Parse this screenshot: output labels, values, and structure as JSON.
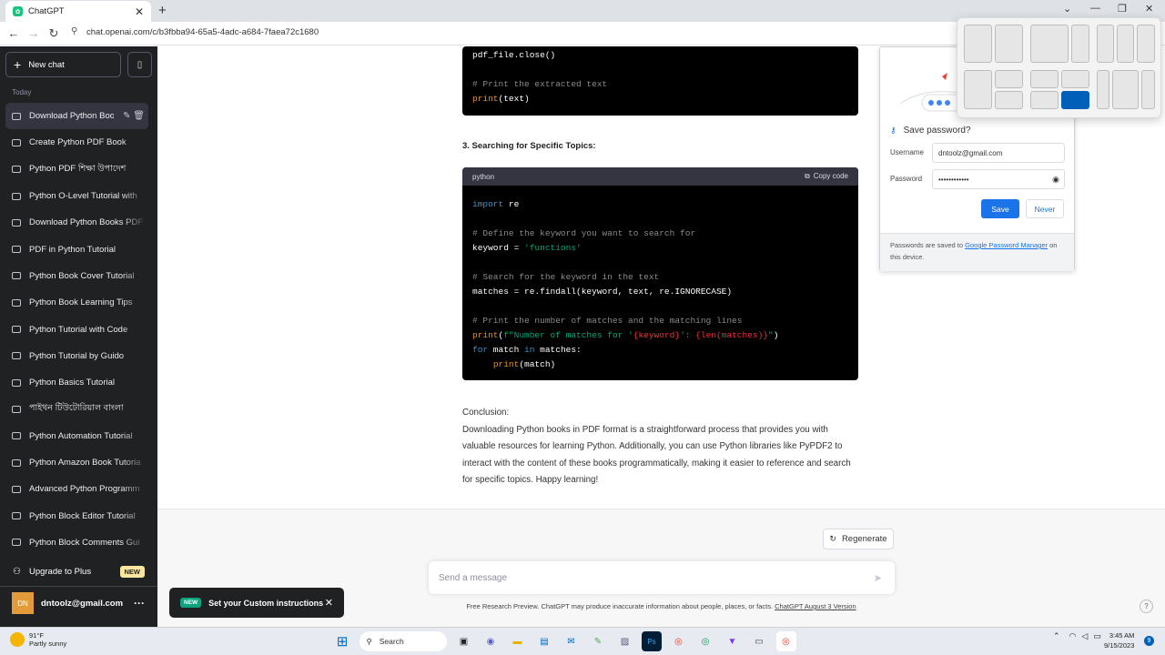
{
  "browser": {
    "tab_title": "ChatGPT",
    "tab_close": "✕",
    "new_tab": "+",
    "url": "chat.openai.com/c/b3fbba94-65a5-4adc-a684-7faea72c1680",
    "controls": {
      "chevron": "⌄",
      "minimize": "—",
      "restore": "❐",
      "close": "✕"
    }
  },
  "sidebar": {
    "new_chat": "New chat",
    "section_label": "Today",
    "items": [
      {
        "label": "Download Python Boo",
        "active": true
      },
      {
        "label": "Create Python PDF Book"
      },
      {
        "label": "Python PDF শিক্ষা উপাদেশ"
      },
      {
        "label": "Python O-Level Tutorial with"
      },
      {
        "label": "Download Python Books PDF"
      },
      {
        "label": "PDF in Python Tutorial"
      },
      {
        "label": "Python Book Cover Tutorial"
      },
      {
        "label": "Python Book Learning Tips"
      },
      {
        "label": "Python Tutorial with Code"
      },
      {
        "label": "Python Tutorial by Guido"
      },
      {
        "label": "Python Basics Tutorial"
      },
      {
        "label": "পাইথন টিউটোরিয়াল বাংলা"
      },
      {
        "label": "Python Automation Tutorial"
      },
      {
        "label": "Python Amazon Book Tutoria"
      },
      {
        "label": "Advanced Python Programm"
      },
      {
        "label": "Python Block Editor Tutorial"
      },
      {
        "label": "Python Block Comments Gui"
      }
    ],
    "upgrade_label": "Upgrade to Plus",
    "upgrade_badge": "NEW",
    "user_avatar": "DN",
    "user_email": "dntoolz@gmail.com",
    "user_menu": "···"
  },
  "conversation": {
    "code1_lines": [
      [
        {
          "t": "pdf_file.close()",
          "c": ""
        }
      ],
      [
        {
          "t": "",
          "c": ""
        }
      ],
      [
        {
          "t": "# Print the extracted text",
          "c": "cm"
        }
      ],
      [
        {
          "t": "print",
          "c": "bi"
        },
        {
          "t": "(text)",
          "c": ""
        }
      ]
    ],
    "heading3": "3. Searching for Specific Topics:",
    "code2_lang": "python",
    "code2_copy": "Copy code",
    "code2_lines": [
      [
        {
          "t": "import",
          "c": "kw"
        },
        {
          "t": " re",
          "c": ""
        }
      ],
      [
        {
          "t": "",
          "c": ""
        }
      ],
      [
        {
          "t": "# Define the keyword you want to search for",
          "c": "cm"
        }
      ],
      [
        {
          "t": "keyword = ",
          "c": ""
        },
        {
          "t": "'functions'",
          "c": "st"
        }
      ],
      [
        {
          "t": "",
          "c": ""
        }
      ],
      [
        {
          "t": "# Search for the keyword in the text",
          "c": "cm"
        }
      ],
      [
        {
          "t": "matches = re.findall(keyword, text, re.IGNORECASE)",
          "c": ""
        }
      ],
      [
        {
          "t": "",
          "c": ""
        }
      ],
      [
        {
          "t": "# Print the number of matches and the matching lines",
          "c": "cm"
        }
      ],
      [
        {
          "t": "print",
          "c": "bi"
        },
        {
          "t": "(",
          "c": ""
        },
        {
          "t": "f\"Number of matches for '",
          "c": "st"
        },
        {
          "t": "{keyword}",
          "c": "fn"
        },
        {
          "t": "': ",
          "c": "st"
        },
        {
          "t": "{len(matches)}",
          "c": "fn"
        },
        {
          "t": "\"",
          "c": "st"
        },
        {
          "t": ")",
          "c": ""
        }
      ],
      [
        {
          "t": "for",
          "c": "kw"
        },
        {
          "t": " match ",
          "c": ""
        },
        {
          "t": "in",
          "c": "kw"
        },
        {
          "t": " matches:",
          "c": ""
        }
      ],
      [
        {
          "t": "    ",
          "c": ""
        },
        {
          "t": "print",
          "c": "bi"
        },
        {
          "t": "(match)",
          "c": ""
        }
      ]
    ],
    "conclusion_title": "Conclusion:",
    "conclusion_text": "Downloading Python books in PDF format is a straightforward process that provides you with valuable resources for learning Python. Additionally, you can use Python libraries like PyPDF2 to interact with the content of these books programmatically, making it easier to reference and search for specific topics. Happy learning!"
  },
  "composer": {
    "regenerate": "Regenerate",
    "placeholder": "Send a message",
    "disclaimer_prefix": "Free Research Preview. ChatGPT may produce inaccurate information about people, places, or facts.",
    "disclaimer_link": "ChatGPT August 3 Version",
    "help": "?"
  },
  "toast": {
    "badge": "NEW",
    "text": "Set your Custom instructions",
    "close": "✕"
  },
  "password_popup": {
    "title": "Save password?",
    "username_label": "Username",
    "username_value": "dntoolz@gmail.com",
    "password_label": "Password",
    "password_value": "••••••••••••",
    "save": "Save",
    "never": "Never",
    "footer_prefix": "Passwords are saved to",
    "footer_link": "Google Password Manager",
    "footer_suffix": "on this device."
  },
  "taskbar": {
    "temperature": "91°F",
    "condition": "Partly sunny",
    "search": "Search",
    "time": "3:45 AM",
    "date": "9/15/2023",
    "notifications": "9"
  },
  "colors": {
    "accent_green": "#10a37f",
    "save_blue": "#1a73e8",
    "snap_highlight": "#005fb8"
  }
}
